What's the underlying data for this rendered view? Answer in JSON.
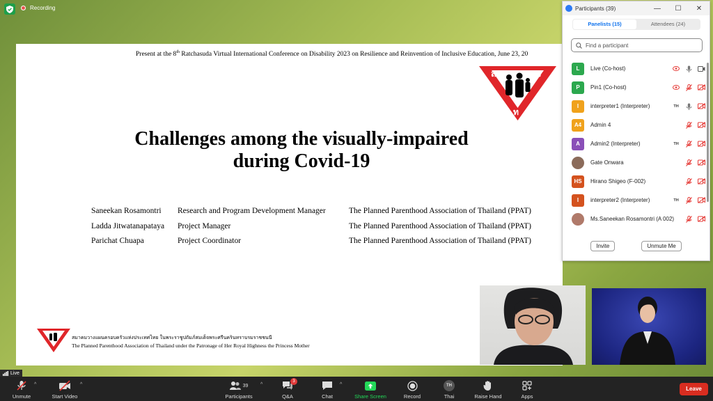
{
  "status": {
    "recording_label": "Recording"
  },
  "colors": {
    "accent": "#0e72ed",
    "leave": "#d92d20",
    "share": "#23d959",
    "recording": "#e8554e",
    "logo_red": "#e0262a"
  },
  "slide": {
    "top_line_pre": "Present at the 8",
    "top_line_sup": "th",
    "top_line_post": " Ratchasuda Virtual International Conference on Disability 2023 on Resilience and Reinvention of Inclusive Education, June 23, 20",
    "title_line1": "Challenges among the visually-impaired",
    "title_line2": "during Covid-19",
    "logo_letters": [
      "ส",
      "ว",
      "ท"
    ],
    "people": [
      {
        "name": "Saneekan Rosamontri",
        "role": "Research and Program Development Manager",
        "org": "The Planned Parenthood Association of Thailand (PPAT)"
      },
      {
        "name": "Ladda Jitwatanapataya",
        "role": "Project Manager",
        "org": "The Planned Parenthood Association of Thailand (PPAT)"
      },
      {
        "name": "Parichat Chuapa",
        "role": "Project Coordinator",
        "org": "The Planned Parenthood Association of Thailand (PPAT)"
      }
    ],
    "footer_thai": "สมาคมวางแผนครอบครัวแห่งประเทศไทย ในพระราชูปถัมภ์สมเด็จพระศรีนครินทราบรมราชชนนี",
    "footer_en": "The Planned Parenthood Association of Thailand under the Patronage of Her Royal Highness the Princess Mother"
  },
  "panel": {
    "title": "Participants (39)",
    "tabs": [
      {
        "label": "Panelists (15)"
      },
      {
        "label": "Attendees (24)"
      }
    ],
    "search_placeholder": "Find a participant",
    "participants": [
      {
        "initials": "L",
        "color": "#2ca84e",
        "name": "Live (Co-host)",
        "th": "",
        "video": "on"
      },
      {
        "initials": "P",
        "color": "#2ca84e",
        "name": "Pin1 (Co-host)",
        "th": "",
        "video": "off"
      },
      {
        "initials": "I",
        "color": "#f0a21c",
        "name": "interpreter1 (Interpreter)",
        "th": "TH",
        "video": "off"
      },
      {
        "initials": "A4",
        "color": "#f0a21c",
        "name": "Admin 4",
        "th": "",
        "video": "off"
      },
      {
        "initials": "A",
        "color": "#8a4fb8",
        "name": "Admin2 (Interpreter)",
        "th": "TH",
        "video": "off"
      },
      {
        "initials": "",
        "color": "#8b6b5a",
        "name": "Gate Onwara",
        "th": "",
        "video": "off"
      },
      {
        "initials": "HS",
        "color": "#d4521e",
        "name": "Hirano Shigeo (F-002)",
        "th": "",
        "video": "off"
      },
      {
        "initials": "I",
        "color": "#d4521e",
        "name": "interpreter2 (Interpreter)",
        "th": "TH",
        "video": "off"
      },
      {
        "initials": "",
        "color": "#b07a6a",
        "name": "Ms.Saneekan Rosamontri (A 002)",
        "th": "",
        "video": "off"
      }
    ],
    "invite_label": "Invite",
    "unmute_me_label": "Unmute Me"
  },
  "bottom": {
    "live_label": "Live",
    "unmute_label": "Unmute",
    "start_video_label": "Start Video",
    "participants_label": "Participants",
    "participants_count": "39",
    "qa_label": "Q&A",
    "qa_badge": "3",
    "chat_label": "Chat",
    "share_label": "Share Screen",
    "record_label": "Record",
    "language_label": "Thai",
    "language_badge": "TH",
    "raise_hand_label": "Raise Hand",
    "apps_label": "Apps",
    "leave_label": "Leave"
  }
}
